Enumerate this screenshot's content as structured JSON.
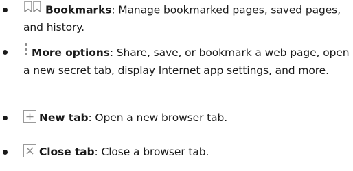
{
  "items": [
    {
      "icon": "bookmarks-icon",
      "title": "Bookmarks",
      "desc": ": Manage bookmarked pages, saved pages, and history."
    },
    {
      "icon": "more-options-icon",
      "title": "More options",
      "desc": ": Share, save, or bookmark a web page, open a new secret tab, display Internet app settings, and more."
    },
    {
      "icon": "new-tab-icon",
      "title": "New tab",
      "desc": ": Open a new browser tab."
    },
    {
      "icon": "close-tab-icon",
      "title": "Close tab",
      "desc": ": Close a browser tab."
    }
  ]
}
